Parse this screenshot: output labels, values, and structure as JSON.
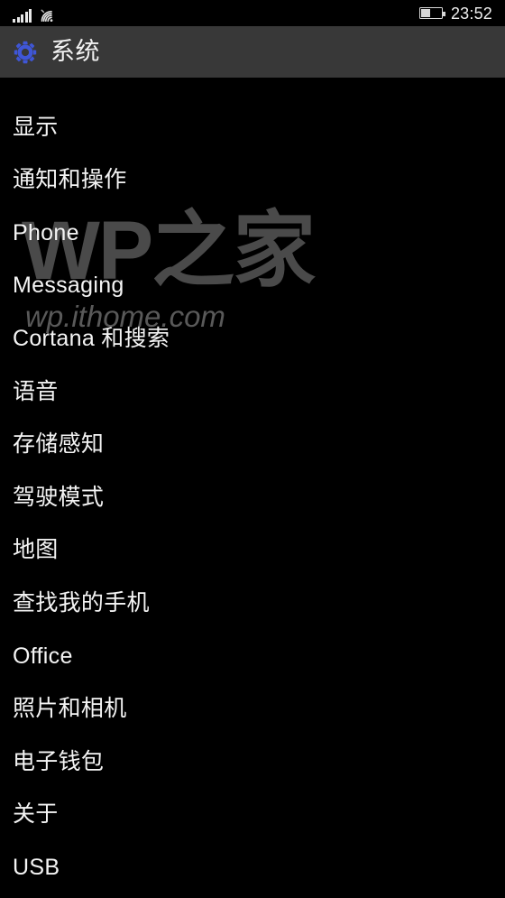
{
  "status_bar": {
    "signal_icon": "cellular-signal-icon",
    "signal_bars": 5,
    "wifi_icon": "wifi-icon",
    "battery_icon": "battery-icon",
    "battery_level_percent": 40,
    "clock": "23:52"
  },
  "header": {
    "icon": "gear-icon",
    "icon_color": "#3f56d6",
    "title": "系统",
    "background_color": "#383838"
  },
  "watermark": {
    "main": "WP之家",
    "sub": "wp.ithome.com",
    "color": "#4a4a4a"
  },
  "settings": {
    "items": [
      {
        "label": "显示"
      },
      {
        "label": "通知和操作"
      },
      {
        "label": "Phone"
      },
      {
        "label": "Messaging"
      },
      {
        "label": "Cortana 和搜索"
      },
      {
        "label": "语音"
      },
      {
        "label": "存储感知"
      },
      {
        "label": "驾驶模式"
      },
      {
        "label": "地图"
      },
      {
        "label": "查找我的手机"
      },
      {
        "label": "Office"
      },
      {
        "label": "照片和相机"
      },
      {
        "label": "电子钱包"
      },
      {
        "label": "关于"
      },
      {
        "label": "USB"
      }
    ]
  },
  "theme": {
    "background": "#000000",
    "text": "#f4f4f4"
  }
}
